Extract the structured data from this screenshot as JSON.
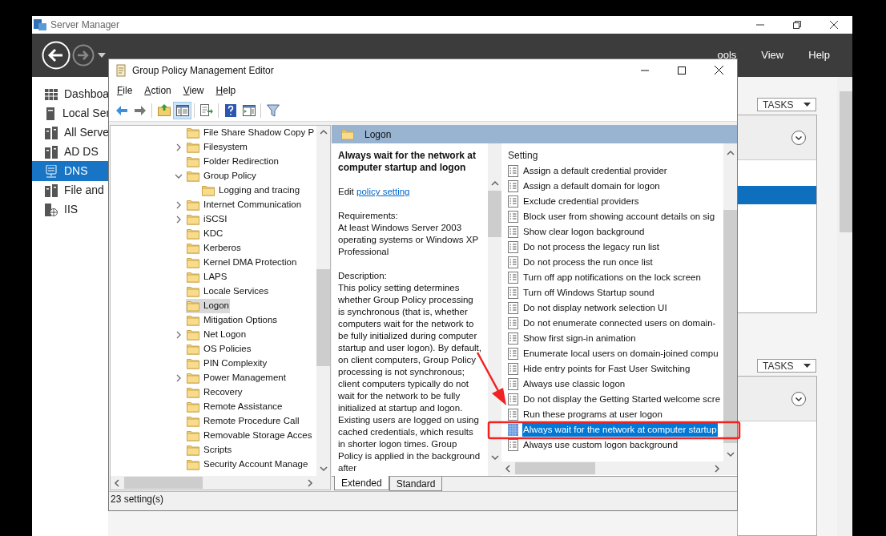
{
  "server_manager": {
    "title": "Server Manager",
    "menu": [
      "ools",
      "View",
      "Help"
    ],
    "sidebar": [
      {
        "label": "Dashboa",
        "kind": "grid",
        "selected": false
      },
      {
        "label": "Local Ser",
        "kind": "server",
        "selected": false
      },
      {
        "label": "All Serve",
        "kind": "servers",
        "selected": false
      },
      {
        "label": "AD DS",
        "kind": "servers",
        "selected": false
      },
      {
        "label": "DNS",
        "kind": "dns",
        "selected": true
      },
      {
        "label": "File and",
        "kind": "servers",
        "selected": false
      },
      {
        "label": "IIS",
        "kind": "iis",
        "selected": false
      }
    ],
    "tasks": [
      "TASKS",
      "TASKS"
    ]
  },
  "editor": {
    "title": "Group Policy Management Editor",
    "menu": [
      "File",
      "Action",
      "View",
      "Help"
    ],
    "toolbar": [
      {
        "kind": "back",
        "pressed": false
      },
      {
        "kind": "forward",
        "pressed": false
      },
      {
        "kind": "folder-up",
        "pressed": false
      },
      {
        "kind": "tree",
        "pressed": true
      },
      {
        "kind": "export",
        "pressed": false
      },
      {
        "kind": "help",
        "pressed": false
      },
      {
        "kind": "panel",
        "pressed": false
      },
      {
        "kind": "filter",
        "pressed": false
      }
    ],
    "tree": [
      {
        "label": "File Share Shadow Copy P",
        "selected": false
      },
      {
        "label": "Filesystem",
        "expanded": false,
        "selected": false
      },
      {
        "label": "Folder Redirection",
        "selected": false
      },
      {
        "label": "Group Policy",
        "expanded": true,
        "selected": false,
        "children": [
          {
            "label": "Logging and tracing",
            "selected": false
          }
        ]
      },
      {
        "label": "Internet Communication",
        "expanded": false,
        "selected": false
      },
      {
        "label": "iSCSI",
        "expanded": false,
        "selected": false
      },
      {
        "label": "KDC",
        "selected": false
      },
      {
        "label": "Kerberos",
        "selected": false
      },
      {
        "label": "Kernel DMA Protection",
        "selected": false
      },
      {
        "label": "LAPS",
        "selected": false
      },
      {
        "label": "Locale Services",
        "selected": false
      },
      {
        "label": "Logon",
        "selected": true
      },
      {
        "label": "Mitigation Options",
        "selected": false
      },
      {
        "label": "Net Logon",
        "expanded": false,
        "selected": false
      },
      {
        "label": "OS Policies",
        "selected": false
      },
      {
        "label": "PIN Complexity",
        "selected": false
      },
      {
        "label": "Power Management",
        "expanded": false,
        "selected": false
      },
      {
        "label": "Recovery",
        "selected": false
      },
      {
        "label": "Remote Assistance",
        "selected": false
      },
      {
        "label": "Remote Procedure Call",
        "selected": false
      },
      {
        "label": "Removable Storage Acces",
        "selected": false
      },
      {
        "label": "Scripts",
        "selected": false
      },
      {
        "label": "Security Account Manage",
        "selected": false
      }
    ],
    "details": {
      "header": "Logon",
      "policy_title": "Always wait for the network at computer startup and logon",
      "edit_prefix": "Edit",
      "edit_link": "policy setting",
      "requirements_label": "Requirements:",
      "requirements": "At least Windows Server 2003 operating systems or Windows XP Professional",
      "description_label": "Description:",
      "description": "This policy setting determines whether Group Policy processing is synchronous (that is, whether computers wait for the network to be fully initialized during computer startup and user logon). By default, on client computers, Group Policy processing is not synchronous; client computers typically do not wait for the network to be fully initialized at startup and logon. Existing users are logged on using cached credentials, which results in shorter logon times. Group Policy is applied in the background after",
      "column": "Setting",
      "settings": [
        {
          "label": "Assign a default credential provider",
          "selected": false
        },
        {
          "label": "Assign a default domain for logon",
          "selected": false
        },
        {
          "label": "Exclude credential providers",
          "selected": false
        },
        {
          "label": "Block user from showing account details on sig",
          "selected": false
        },
        {
          "label": "Show clear logon background",
          "selected": false
        },
        {
          "label": "Do not process the legacy run list",
          "selected": false
        },
        {
          "label": "Do not process the run once list",
          "selected": false
        },
        {
          "label": "Turn off app notifications on the lock screen",
          "selected": false
        },
        {
          "label": "Turn off Windows Startup sound",
          "selected": false
        },
        {
          "label": "Do not display network selection UI",
          "selected": false
        },
        {
          "label": "Do not enumerate connected users on domain-",
          "selected": false
        },
        {
          "label": "Show first sign-in animation",
          "selected": false
        },
        {
          "label": "Enumerate local users on domain-joined compu",
          "selected": false
        },
        {
          "label": "Hide entry points for Fast User Switching",
          "selected": false
        },
        {
          "label": "Always use classic logon",
          "selected": false
        },
        {
          "label": "Do not display the Getting Started welcome scre",
          "selected": false
        },
        {
          "label": "Run these programs at user logon",
          "selected": false
        },
        {
          "label": "Always wait for the network at computer startup",
          "selected": true
        },
        {
          "label": "Always use custom logon background",
          "selected": false
        }
      ]
    },
    "tabs": [
      {
        "label": "Extended",
        "selected": true
      },
      {
        "label": "Standard",
        "selected": false
      }
    ],
    "status": "23 setting(s)"
  }
}
